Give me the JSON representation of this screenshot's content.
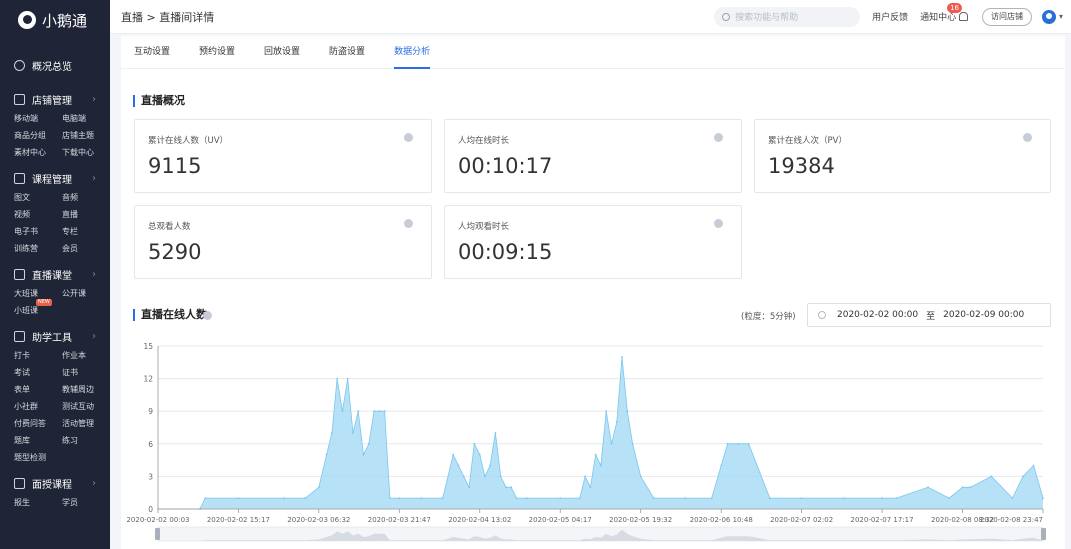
{
  "app": {
    "name": "小鹅通"
  },
  "sidebar": {
    "overview": "概况总览",
    "sections": [
      {
        "title": "店铺管理",
        "items": [
          "移动端",
          "电脑端",
          "商品分组",
          "店铺主题",
          "素材中心",
          "下载中心"
        ]
      },
      {
        "title": "课程管理",
        "items": [
          "图文",
          "音频",
          "视频",
          "直播",
          "电子书",
          "专栏",
          "训练营",
          "会员"
        ]
      },
      {
        "title": "直播课堂",
        "badge": "NEW",
        "items": [
          "大班课",
          "公开课",
          "小班课"
        ]
      },
      {
        "title": "助学工具",
        "items": [
          "打卡",
          "作业本",
          "考试",
          "证书",
          "表单",
          "教辅周边",
          "小社群",
          "测试互动",
          "付费问答",
          "活动管理",
          "题库",
          "练习",
          "题型检测"
        ]
      },
      {
        "title": "面授课程",
        "items": [
          "报生",
          "学员"
        ]
      }
    ]
  },
  "topbar": {
    "breadcrumb": "直播 > 直播间详情",
    "search_placeholder": "搜索功能与帮助",
    "feedback": "用户反馈",
    "notifications": "通知中心",
    "notif_count": "16",
    "visit_store": "访问店铺"
  },
  "tabs": [
    {
      "label": "互动设置"
    },
    {
      "label": "预约设置"
    },
    {
      "label": "回放设置"
    },
    {
      "label": "防盗设置"
    },
    {
      "label": "数据分析",
      "active": true
    }
  ],
  "overview": {
    "title": "直播概况",
    "cards": [
      {
        "label": "累计在线人数（UV）",
        "value": "9115"
      },
      {
        "label": "人均在线时长",
        "value": "00:10:17"
      },
      {
        "label": "累计在线人次（PV）",
        "value": "19384"
      },
      {
        "label": "总观看人数",
        "value": "5290"
      },
      {
        "label": "人均观看时长",
        "value": "00:09:15"
      }
    ]
  },
  "online": {
    "title": "直播在线人数",
    "granularity": "(粒度：5分钟)",
    "range_start": "2020-02-02 00:00",
    "range_sep": "至",
    "range_end": "2020-02-09 00:00"
  },
  "colors": {
    "accent": "#2b6de6",
    "area_fill": "#a9dcf5",
    "area_stroke": "#7cc6ee"
  },
  "chart_data": {
    "type": "area",
    "ylim": [
      0,
      15
    ],
    "yticks": [
      0,
      3,
      6,
      9,
      12,
      15
    ],
    "xticks": [
      "2020-02-02 00:03",
      "2020-02-02 15:17",
      "2020-02-03 06:32",
      "2020-02-03 21:47",
      "2020-02-04 13:02",
      "2020-02-05 04:17",
      "2020-02-05 19:32",
      "2020-02-06 10:48",
      "2020-02-07 02:02",
      "2020-02-07 17:17",
      "2020-02-08 08:32",
      "2020-02-08 23:47"
    ],
    "x": [
      "2020-02-02 00:03",
      "2020-02-02 08:00",
      "2020-02-02 09:00",
      "2020-02-02 15:17",
      "2020-02-03 00:00",
      "2020-02-03 04:00",
      "2020-02-03 06:32",
      "2020-02-03 08:00",
      "2020-02-03 09:00",
      "2020-02-03 10:00",
      "2020-02-03 11:00",
      "2020-02-03 12:00",
      "2020-02-03 13:00",
      "2020-02-03 14:00",
      "2020-02-03 15:00",
      "2020-02-03 16:00",
      "2020-02-03 17:00",
      "2020-02-03 18:00",
      "2020-02-03 19:00",
      "2020-02-03 20:00",
      "2020-02-03 21:47",
      "2020-02-04 02:00",
      "2020-02-04 06:00",
      "2020-02-04 08:00",
      "2020-02-04 09:00",
      "2020-02-04 10:00",
      "2020-02-04 11:00",
      "2020-02-04 12:00",
      "2020-02-04 13:02",
      "2020-02-04 14:00",
      "2020-02-04 15:00",
      "2020-02-04 16:00",
      "2020-02-04 17:00",
      "2020-02-04 18:00",
      "2020-02-04 19:00",
      "2020-02-04 20:00",
      "2020-02-04 22:00",
      "2020-02-05 04:17",
      "2020-02-05 08:00",
      "2020-02-05 09:00",
      "2020-02-05 10:00",
      "2020-02-05 11:00",
      "2020-02-05 12:00",
      "2020-02-05 13:00",
      "2020-02-05 14:00",
      "2020-02-05 15:00",
      "2020-02-05 16:00",
      "2020-02-05 17:00",
      "2020-02-05 18:00",
      "2020-02-05 19:32",
      "2020-02-05 22:00",
      "2020-02-06 04:00",
      "2020-02-06 09:00",
      "2020-02-06 10:48",
      "2020-02-06 12:00",
      "2020-02-06 14:00",
      "2020-02-06 16:00",
      "2020-02-06 20:00",
      "2020-02-07 02:02",
      "2020-02-07 10:00",
      "2020-02-07 17:17",
      "2020-02-07 20:00",
      "2020-02-08 02:00",
      "2020-02-08 06:00",
      "2020-02-08 08:32",
      "2020-02-08 10:00",
      "2020-02-08 14:00",
      "2020-02-08 18:00",
      "2020-02-08 20:00",
      "2020-02-08 22:00",
      "2020-02-08 23:47"
    ],
    "y": [
      0,
      0,
      1,
      1,
      1,
      1,
      2,
      5,
      7,
      12,
      9,
      12,
      7,
      9,
      5,
      6,
      9,
      9,
      9,
      1,
      1,
      1,
      1,
      5,
      4,
      3,
      2,
      6,
      5,
      3,
      4,
      7,
      3,
      2,
      2,
      1,
      1,
      1,
      1,
      3,
      2,
      5,
      4,
      9,
      6,
      8,
      14,
      9,
      6,
      3,
      1,
      1,
      1,
      4,
      6,
      6,
      6,
      1,
      1,
      1,
      1,
      1,
      2,
      1,
      2,
      2,
      3,
      1,
      3,
      4,
      1
    ]
  }
}
